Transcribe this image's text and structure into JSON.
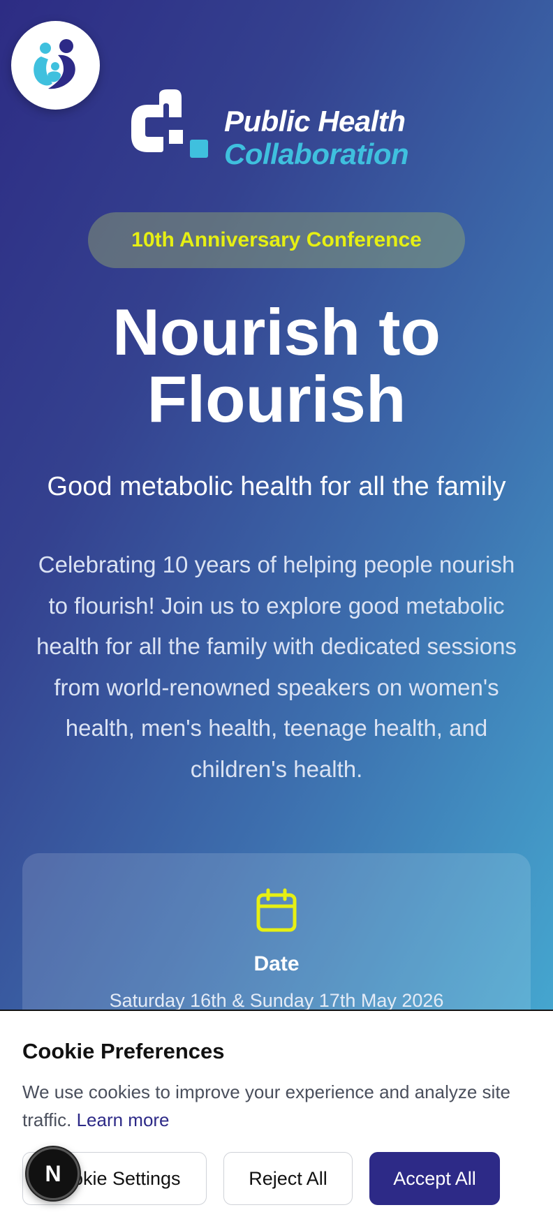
{
  "brand": {
    "line1": "Public Health",
    "line2": "Collaboration",
    "primary_color": "#2d2a87",
    "accent_color": "#3fc0de",
    "highlight_color": "#e6ef13"
  },
  "hero": {
    "badge": "10th Anniversary Conference",
    "title_line1": "Nourish to",
    "title_line2": "Flourish",
    "subtitle": "Good metabolic health for all the family",
    "intro": "Celebrating 10 years of helping people nourish to flourish! Join us to explore good metabolic health for all the family with dedicated sessions from world-renowned speakers on women's health, men's health, teenage health, and children's health."
  },
  "date_card": {
    "icon": "calendar-icon",
    "label": "Date",
    "value": "Saturday 16th & Sunday 17th May 2026"
  },
  "cookie_banner": {
    "title": "Cookie Preferences",
    "text": "We use cookies to improve your experience and analyze site traffic.",
    "link": "Learn more",
    "settings_button": "Cookie Settings",
    "reject_button": "Reject All",
    "accept_button": "Accept All"
  },
  "dev_badge": {
    "letter": "N"
  }
}
